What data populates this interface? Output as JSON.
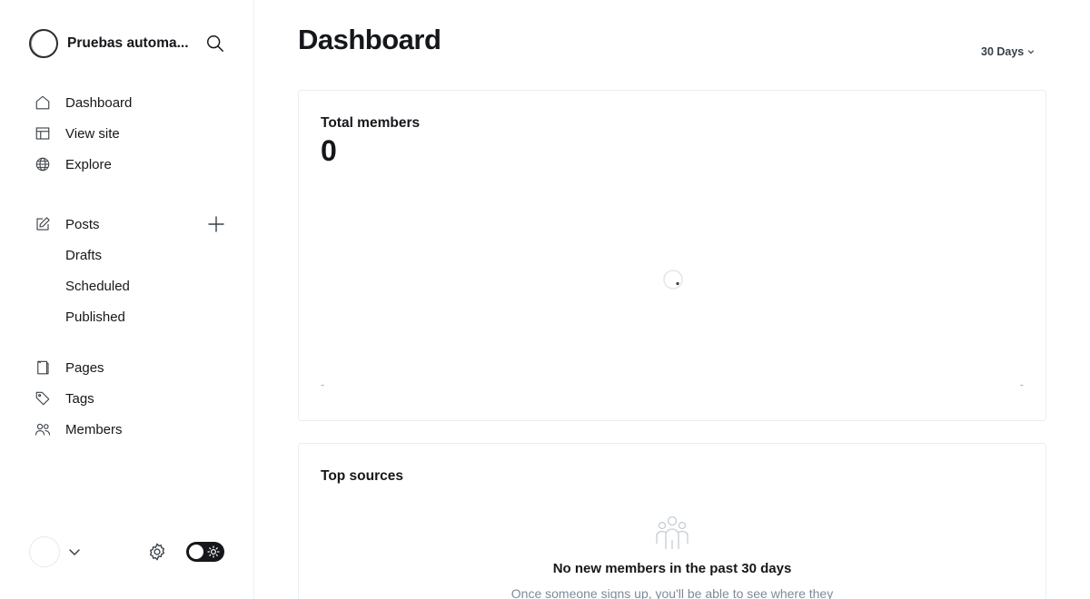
{
  "sidebar": {
    "site_name": "Pruebas automa...",
    "nav_primary": [
      {
        "label": "Dashboard",
        "icon": "home-icon"
      },
      {
        "label": "View site",
        "icon": "layout-icon"
      },
      {
        "label": "Explore",
        "icon": "globe-icon"
      }
    ],
    "posts": {
      "label": "Posts",
      "icon": "pen-icon",
      "sub": [
        "Drafts",
        "Scheduled",
        "Published"
      ]
    },
    "nav_secondary": [
      {
        "label": "Pages",
        "icon": "pages-icon"
      },
      {
        "label": "Tags",
        "icon": "tag-icon"
      },
      {
        "label": "Members",
        "icon": "members-icon"
      }
    ],
    "theme_toggle": "dark"
  },
  "main": {
    "title": "Dashboard",
    "date_range": "30 Days",
    "total_members": {
      "label": "Total members",
      "value": "0",
      "axis_start": "-",
      "axis_end": "-"
    },
    "top_sources": {
      "label": "Top sources",
      "empty_title": "No new members in the past 30 days",
      "empty_desc": "Once someone signs up, you'll be able to see where they"
    }
  },
  "colors": {
    "text": "#15171a",
    "muted": "#7c8b9a",
    "border": "#ebeef0",
    "toggle": "#15171a"
  }
}
